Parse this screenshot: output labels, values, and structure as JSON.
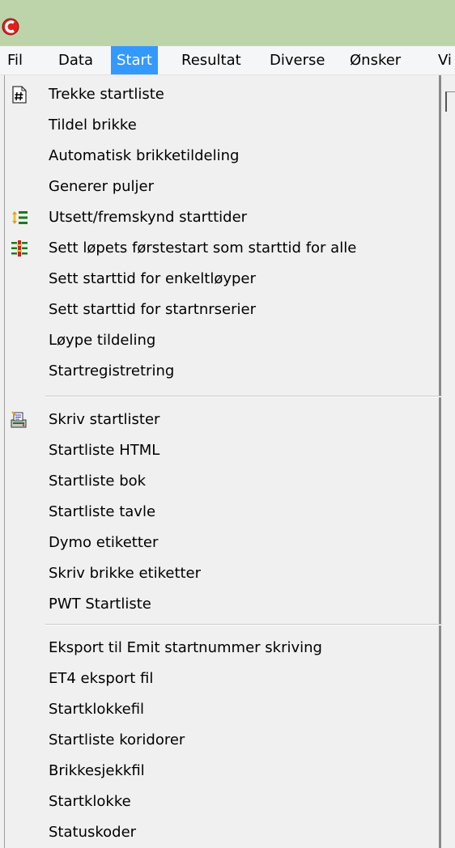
{
  "window": {
    "icon": "app-logo-icon",
    "icon_color": "#e02020"
  },
  "menubar": {
    "items": [
      {
        "label": "Fil"
      },
      {
        "label": "Data"
      },
      {
        "label": "Start"
      },
      {
        "label": "Resultat"
      },
      {
        "label": "Diverse"
      },
      {
        "label": "Ønsker"
      },
      {
        "label": "Vi"
      }
    ],
    "active_color": "#3399ff"
  },
  "dropdown": {
    "groups": [
      {
        "items": [
          {
            "label": "Trekke startliste",
            "icon": "hash-document-icon"
          },
          {
            "label": "Tildel brikke"
          },
          {
            "label": "Automatisk brikketildeling"
          },
          {
            "label": "Generer puljer"
          },
          {
            "label": "Utsett/fremskynd starttider",
            "icon": "shift-times-icon"
          },
          {
            "label": "Sett løpets førstestart som starttid for alle",
            "icon": "first-start-icon"
          },
          {
            "label": "Sett starttid for enkeltløyper"
          },
          {
            "label": "Sett starttid for startnrserier"
          },
          {
            "label": "Løype tildeling"
          },
          {
            "label": "Startregistretring"
          }
        ]
      },
      {
        "items": [
          {
            "label": "Skriv startlister",
            "icon": "print-list-icon"
          },
          {
            "label": "Startliste HTML"
          },
          {
            "label": "Startliste bok"
          },
          {
            "label": "Startliste tavle"
          },
          {
            "label": "Dymo etiketter"
          },
          {
            "label": "Skriv brikke etiketter"
          },
          {
            "label": "PWT Startliste"
          }
        ]
      },
      {
        "items": [
          {
            "label": "Eksport til Emit startnummer skriving"
          },
          {
            "label": "ET4 eksport fil"
          },
          {
            "label": "Startklokkefil"
          },
          {
            "label": "Startliste koridorer"
          },
          {
            "label": "Brikkesjekkfil"
          },
          {
            "label": "Startklokke"
          },
          {
            "label": "Statuskoder"
          }
        ]
      }
    ]
  }
}
